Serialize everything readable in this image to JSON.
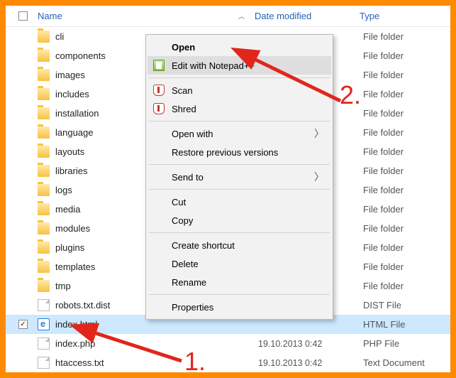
{
  "header": {
    "name": "Name",
    "date": "Date modified",
    "type": "Type"
  },
  "files": [
    {
      "name": "cli",
      "icon": "folder",
      "date": "",
      "type": "File folder",
      "sel": false
    },
    {
      "name": "components",
      "icon": "folder",
      "date": "",
      "type": "File folder",
      "sel": false
    },
    {
      "name": "images",
      "icon": "folder",
      "date": "",
      "type": "File folder",
      "sel": false
    },
    {
      "name": "includes",
      "icon": "folder",
      "date": "",
      "type": "File folder",
      "sel": false
    },
    {
      "name": "installation",
      "icon": "folder",
      "date": "",
      "type": "File folder",
      "sel": false
    },
    {
      "name": "language",
      "icon": "folder",
      "date": "",
      "type": "File folder",
      "sel": false
    },
    {
      "name": "layouts",
      "icon": "folder",
      "date": "",
      "type": "File folder",
      "sel": false
    },
    {
      "name": "libraries",
      "icon": "folder",
      "date": "",
      "type": "File folder",
      "sel": false
    },
    {
      "name": "logs",
      "icon": "folder",
      "date": "",
      "type": "File folder",
      "sel": false
    },
    {
      "name": "media",
      "icon": "folder",
      "date": "",
      "type": "File folder",
      "sel": false
    },
    {
      "name": "modules",
      "icon": "folder",
      "date": "",
      "type": "File folder",
      "sel": false
    },
    {
      "name": "plugins",
      "icon": "folder",
      "date": "",
      "type": "File folder",
      "sel": false
    },
    {
      "name": "templates",
      "icon": "folder",
      "date": "",
      "type": "File folder",
      "sel": false
    },
    {
      "name": "tmp",
      "icon": "folder",
      "date": "",
      "type": "File folder",
      "sel": false
    },
    {
      "name": "robots.txt.dist",
      "icon": "file",
      "date": "",
      "type": "DIST File",
      "sel": false
    },
    {
      "name": "index.html",
      "icon": "edge",
      "date": "",
      "type": "HTML File",
      "sel": true
    },
    {
      "name": "index.php",
      "icon": "file",
      "date": "19.10.2013 0:42",
      "type": "PHP File",
      "sel": false
    },
    {
      "name": "htaccess.txt",
      "icon": "file",
      "date": "19.10.2013 0:42",
      "type": "Text Document",
      "sel": false
    }
  ],
  "menu": [
    {
      "kind": "item",
      "label": "Open",
      "bold": true
    },
    {
      "kind": "item",
      "label": "Edit with Notepad++",
      "icon": "npp",
      "hover": true
    },
    {
      "kind": "sep"
    },
    {
      "kind": "item",
      "label": "Scan",
      "icon": "shield"
    },
    {
      "kind": "item",
      "label": "Shred",
      "icon": "shield"
    },
    {
      "kind": "sep"
    },
    {
      "kind": "item",
      "label": "Open with",
      "sub": true
    },
    {
      "kind": "item",
      "label": "Restore previous versions"
    },
    {
      "kind": "sep"
    },
    {
      "kind": "item",
      "label": "Send to",
      "sub": true
    },
    {
      "kind": "sep"
    },
    {
      "kind": "item",
      "label": "Cut"
    },
    {
      "kind": "item",
      "label": "Copy"
    },
    {
      "kind": "sep"
    },
    {
      "kind": "item",
      "label": "Create shortcut"
    },
    {
      "kind": "item",
      "label": "Delete"
    },
    {
      "kind": "item",
      "label": "Rename"
    },
    {
      "kind": "sep"
    },
    {
      "kind": "item",
      "label": "Properties"
    }
  ],
  "annotations": {
    "step1": "1.",
    "step2": "2."
  }
}
